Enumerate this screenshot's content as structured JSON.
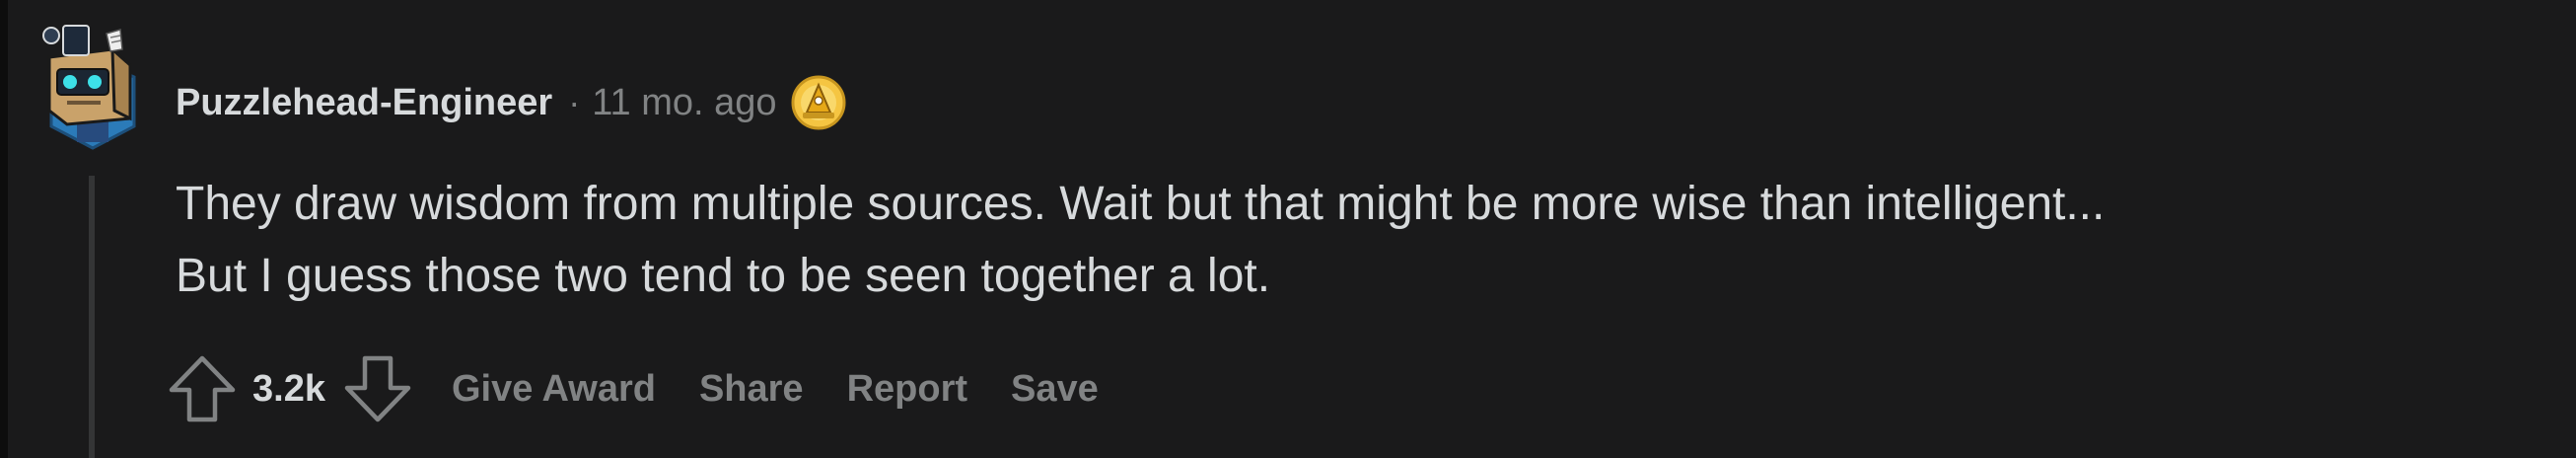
{
  "comment": {
    "author": "Puzzlehead-Engineer",
    "separator": "·",
    "timestamp": "11 mo. ago",
    "award_icon": "gold-award-icon",
    "avatar_icon": "robot-box-avatar",
    "body_lines": [
      "They draw wisdom from multiple sources. Wait but that might be more wise than intelligent...",
      "But I guess those two tend to be seen together a lot."
    ],
    "score": "3.2k"
  },
  "actions": {
    "give_award": "Give Award",
    "share": "Share",
    "report": "Report",
    "save": "Save"
  },
  "colors": {
    "background": "#1a1a1b",
    "text": "#d7dadc",
    "muted": "#818384",
    "thread_line": "#343536"
  }
}
